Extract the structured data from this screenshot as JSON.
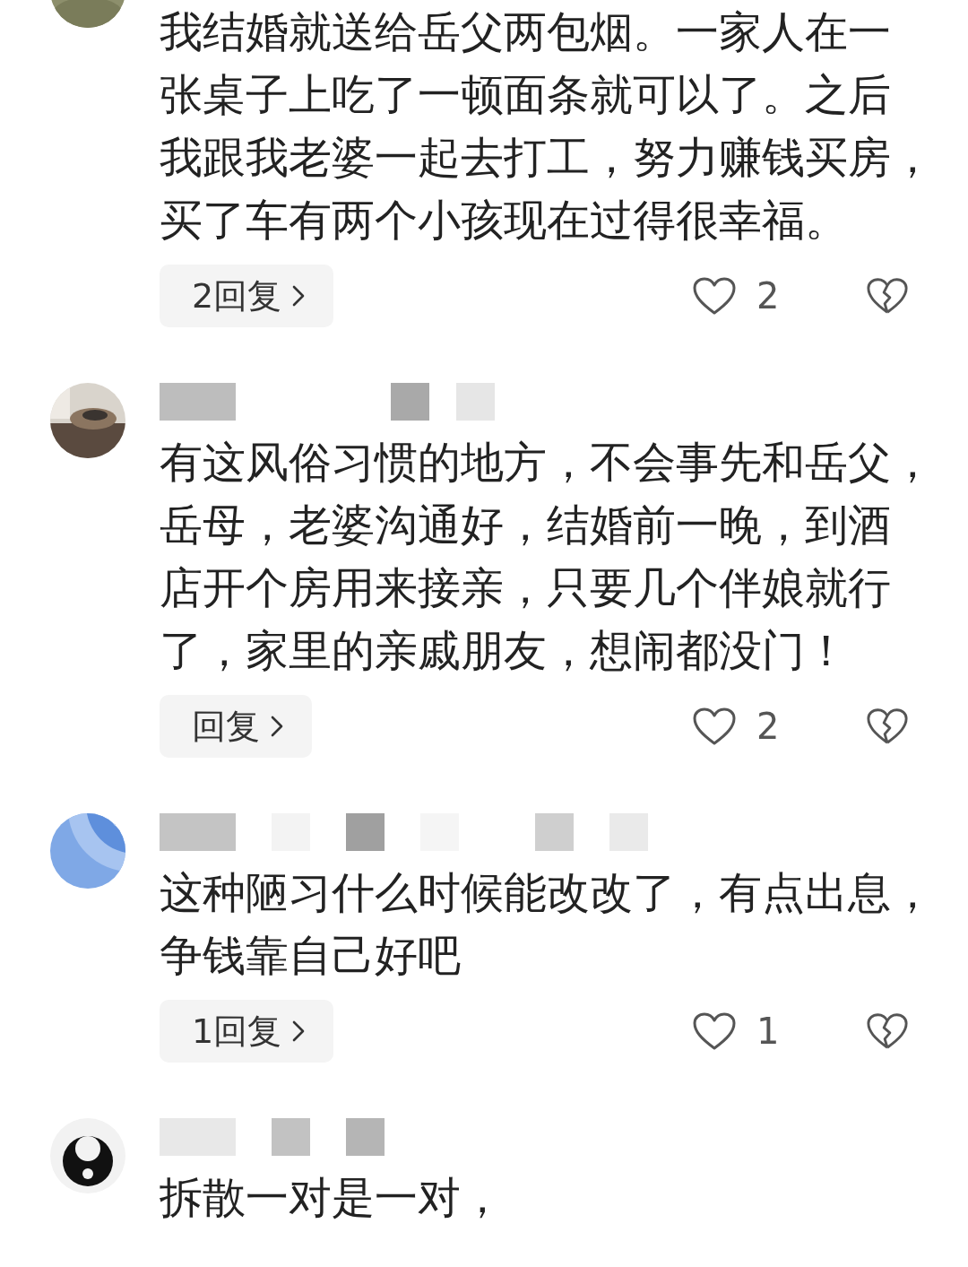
{
  "comments": [
    {
      "avatar": {
        "kind": "picture"
      },
      "lines": [
        "我结婚就送给岳父两包烟。一家人在一",
        "张桌子上吃了一顿面条就可以了。之后",
        "我跟我老婆一起去打工，努力赚钱买房，",
        "买了车有两个小孩现在过得很幸福。"
      ],
      "reply": {
        "label": "2回复"
      },
      "likes": "2",
      "liked": false
    },
    {
      "avatar": {
        "kind": "picture"
      },
      "lines": [
        "有这风俗习惯的地方，不会事先和岳父，",
        "岳母，老婆沟通好，结婚前一晚，到酒",
        "店开个房用来接亲，只要几个伴娘就行",
        "了，家里的亲戚朋友，想闹都没门！"
      ],
      "reply": {
        "label": "回复"
      },
      "likes": "2",
      "liked": false
    },
    {
      "avatar": {
        "kind": "picture"
      },
      "lines": [
        "这种陋习什么时候能改改了，有点出息，",
        "争钱靠自己好吧"
      ],
      "reply": {
        "label": "1回复"
      },
      "likes": "1",
      "liked": false
    },
    {
      "avatar": {
        "kind": "picture"
      },
      "lines": [
        "拆散一对是一对，"
      ]
    }
  ]
}
